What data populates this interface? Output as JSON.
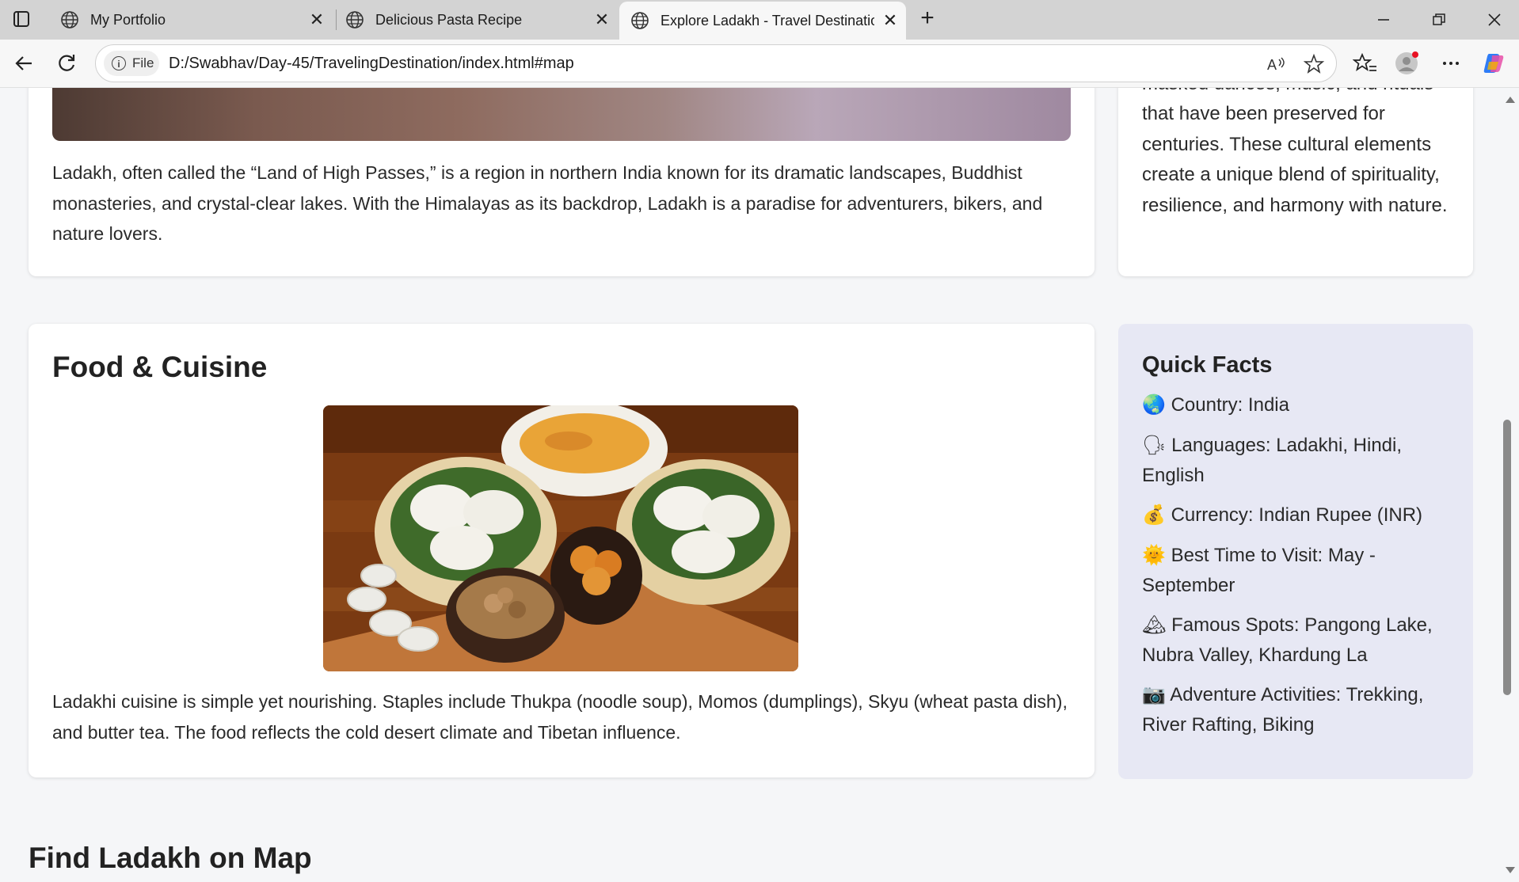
{
  "browser": {
    "tabs": [
      {
        "title": "My Portfolio"
      },
      {
        "title": "Delicious Pasta Recipe"
      },
      {
        "title": "Explore Ladakh - Travel Destinatio"
      }
    ],
    "address_bar": {
      "site_info_label": "File",
      "url": "D:/Swabhav/Day-45/TravelingDestination/index.html#map"
    }
  },
  "page": {
    "intro_paragraph": "Ladakh, often called the “Land of High Passes,” is a region in northern India known for its dramatic landscapes, Buddhist monasteries, and crystal-clear lakes. With the Himalayas as its backdrop, Ladakh is a paradise for adventurers, bikers, and nature lovers.",
    "culture_partial_top": "masked dances, music, and rituals",
    "culture_paragraph": "that have been preserved for centuries. These cultural elements create a unique blend of spirituality, resilience, and harmony with nature.",
    "food": {
      "title": "Food & Cuisine",
      "paragraph": "Ladakhi cuisine is simple yet nourishing. Staples include Thukpa (noodle soup), Momos (dumplings), Skyu (wheat pasta dish), and butter tea. The food reflects the cold desert climate and Tibetan influence."
    },
    "quick_facts": {
      "title": "Quick Facts",
      "items": [
        {
          "emoji": "🌏",
          "text": "Country: India"
        },
        {
          "emoji": "🗣",
          "text": "Languages: Ladakhi, Hindi, English"
        },
        {
          "emoji": "💰",
          "text": "Currency: Indian Rupee (INR)"
        },
        {
          "emoji": "🌞",
          "text": "Best Time to Visit: May - September"
        },
        {
          "emoji": "🏔",
          "text": "Famous Spots: Pangong Lake, Nubra Valley, Khardung La"
        },
        {
          "emoji": "📷",
          "text": "Adventure Activities: Trekking, River Rafting, Biking"
        }
      ]
    },
    "map_title": "Find Ladakh on Map"
  }
}
